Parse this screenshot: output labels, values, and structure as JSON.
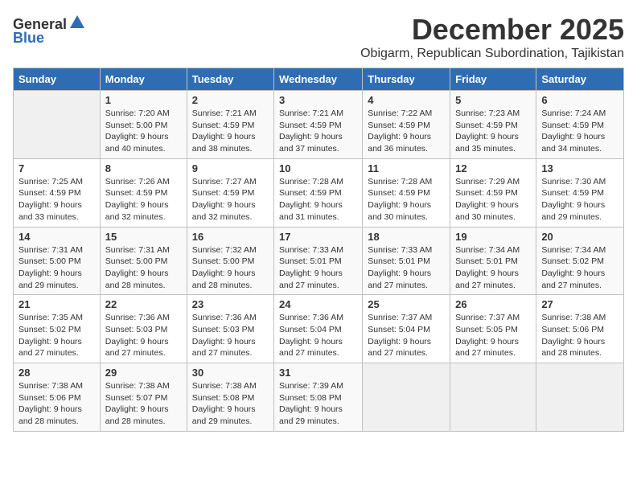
{
  "header": {
    "logo_general": "General",
    "logo_blue": "Blue",
    "month": "December 2025",
    "location": "Obigarm, Republican Subordination, Tajikistan"
  },
  "weekdays": [
    "Sunday",
    "Monday",
    "Tuesday",
    "Wednesday",
    "Thursday",
    "Friday",
    "Saturday"
  ],
  "weeks": [
    [
      {
        "day": "",
        "detail": ""
      },
      {
        "day": "1",
        "detail": "Sunrise: 7:20 AM\nSunset: 5:00 PM\nDaylight: 9 hours\nand 40 minutes."
      },
      {
        "day": "2",
        "detail": "Sunrise: 7:21 AM\nSunset: 4:59 PM\nDaylight: 9 hours\nand 38 minutes."
      },
      {
        "day": "3",
        "detail": "Sunrise: 7:21 AM\nSunset: 4:59 PM\nDaylight: 9 hours\nand 37 minutes."
      },
      {
        "day": "4",
        "detail": "Sunrise: 7:22 AM\nSunset: 4:59 PM\nDaylight: 9 hours\nand 36 minutes."
      },
      {
        "day": "5",
        "detail": "Sunrise: 7:23 AM\nSunset: 4:59 PM\nDaylight: 9 hours\nand 35 minutes."
      },
      {
        "day": "6",
        "detail": "Sunrise: 7:24 AM\nSunset: 4:59 PM\nDaylight: 9 hours\nand 34 minutes."
      }
    ],
    [
      {
        "day": "7",
        "detail": "Sunrise: 7:25 AM\nSunset: 4:59 PM\nDaylight: 9 hours\nand 33 minutes."
      },
      {
        "day": "8",
        "detail": "Sunrise: 7:26 AM\nSunset: 4:59 PM\nDaylight: 9 hours\nand 32 minutes."
      },
      {
        "day": "9",
        "detail": "Sunrise: 7:27 AM\nSunset: 4:59 PM\nDaylight: 9 hours\nand 32 minutes."
      },
      {
        "day": "10",
        "detail": "Sunrise: 7:28 AM\nSunset: 4:59 PM\nDaylight: 9 hours\nand 31 minutes."
      },
      {
        "day": "11",
        "detail": "Sunrise: 7:28 AM\nSunset: 4:59 PM\nDaylight: 9 hours\nand 30 minutes."
      },
      {
        "day": "12",
        "detail": "Sunrise: 7:29 AM\nSunset: 4:59 PM\nDaylight: 9 hours\nand 30 minutes."
      },
      {
        "day": "13",
        "detail": "Sunrise: 7:30 AM\nSunset: 4:59 PM\nDaylight: 9 hours\nand 29 minutes."
      }
    ],
    [
      {
        "day": "14",
        "detail": "Sunrise: 7:31 AM\nSunset: 5:00 PM\nDaylight: 9 hours\nand 29 minutes."
      },
      {
        "day": "15",
        "detail": "Sunrise: 7:31 AM\nSunset: 5:00 PM\nDaylight: 9 hours\nand 28 minutes."
      },
      {
        "day": "16",
        "detail": "Sunrise: 7:32 AM\nSunset: 5:00 PM\nDaylight: 9 hours\nand 28 minutes."
      },
      {
        "day": "17",
        "detail": "Sunrise: 7:33 AM\nSunset: 5:01 PM\nDaylight: 9 hours\nand 27 minutes."
      },
      {
        "day": "18",
        "detail": "Sunrise: 7:33 AM\nSunset: 5:01 PM\nDaylight: 9 hours\nand 27 minutes."
      },
      {
        "day": "19",
        "detail": "Sunrise: 7:34 AM\nSunset: 5:01 PM\nDaylight: 9 hours\nand 27 minutes."
      },
      {
        "day": "20",
        "detail": "Sunrise: 7:34 AM\nSunset: 5:02 PM\nDaylight: 9 hours\nand 27 minutes."
      }
    ],
    [
      {
        "day": "21",
        "detail": "Sunrise: 7:35 AM\nSunset: 5:02 PM\nDaylight: 9 hours\nand 27 minutes."
      },
      {
        "day": "22",
        "detail": "Sunrise: 7:36 AM\nSunset: 5:03 PM\nDaylight: 9 hours\nand 27 minutes."
      },
      {
        "day": "23",
        "detail": "Sunrise: 7:36 AM\nSunset: 5:03 PM\nDaylight: 9 hours\nand 27 minutes."
      },
      {
        "day": "24",
        "detail": "Sunrise: 7:36 AM\nSunset: 5:04 PM\nDaylight: 9 hours\nand 27 minutes."
      },
      {
        "day": "25",
        "detail": "Sunrise: 7:37 AM\nSunset: 5:04 PM\nDaylight: 9 hours\nand 27 minutes."
      },
      {
        "day": "26",
        "detail": "Sunrise: 7:37 AM\nSunset: 5:05 PM\nDaylight: 9 hours\nand 27 minutes."
      },
      {
        "day": "27",
        "detail": "Sunrise: 7:38 AM\nSunset: 5:06 PM\nDaylight: 9 hours\nand 28 minutes."
      }
    ],
    [
      {
        "day": "28",
        "detail": "Sunrise: 7:38 AM\nSunset: 5:06 PM\nDaylight: 9 hours\nand 28 minutes."
      },
      {
        "day": "29",
        "detail": "Sunrise: 7:38 AM\nSunset: 5:07 PM\nDaylight: 9 hours\nand 28 minutes."
      },
      {
        "day": "30",
        "detail": "Sunrise: 7:38 AM\nSunset: 5:08 PM\nDaylight: 9 hours\nand 29 minutes."
      },
      {
        "day": "31",
        "detail": "Sunrise: 7:39 AM\nSunset: 5:08 PM\nDaylight: 9 hours\nand 29 minutes."
      },
      {
        "day": "",
        "detail": ""
      },
      {
        "day": "",
        "detail": ""
      },
      {
        "day": "",
        "detail": ""
      }
    ]
  ]
}
